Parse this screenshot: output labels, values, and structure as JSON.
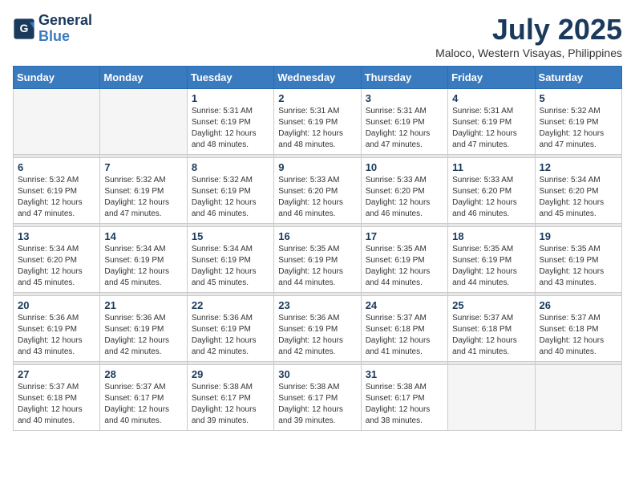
{
  "header": {
    "logo_line1": "General",
    "logo_line2": "Blue",
    "title": "July 2025",
    "subtitle": "Maloco, Western Visayas, Philippines"
  },
  "days_of_week": [
    "Sunday",
    "Monday",
    "Tuesday",
    "Wednesday",
    "Thursday",
    "Friday",
    "Saturday"
  ],
  "weeks": [
    [
      {
        "num": "",
        "info": ""
      },
      {
        "num": "",
        "info": ""
      },
      {
        "num": "1",
        "info": "Sunrise: 5:31 AM\nSunset: 6:19 PM\nDaylight: 12 hours\nand 48 minutes."
      },
      {
        "num": "2",
        "info": "Sunrise: 5:31 AM\nSunset: 6:19 PM\nDaylight: 12 hours\nand 48 minutes."
      },
      {
        "num": "3",
        "info": "Sunrise: 5:31 AM\nSunset: 6:19 PM\nDaylight: 12 hours\nand 47 minutes."
      },
      {
        "num": "4",
        "info": "Sunrise: 5:31 AM\nSunset: 6:19 PM\nDaylight: 12 hours\nand 47 minutes."
      },
      {
        "num": "5",
        "info": "Sunrise: 5:32 AM\nSunset: 6:19 PM\nDaylight: 12 hours\nand 47 minutes."
      }
    ],
    [
      {
        "num": "6",
        "info": "Sunrise: 5:32 AM\nSunset: 6:19 PM\nDaylight: 12 hours\nand 47 minutes."
      },
      {
        "num": "7",
        "info": "Sunrise: 5:32 AM\nSunset: 6:19 PM\nDaylight: 12 hours\nand 47 minutes."
      },
      {
        "num": "8",
        "info": "Sunrise: 5:32 AM\nSunset: 6:19 PM\nDaylight: 12 hours\nand 46 minutes."
      },
      {
        "num": "9",
        "info": "Sunrise: 5:33 AM\nSunset: 6:20 PM\nDaylight: 12 hours\nand 46 minutes."
      },
      {
        "num": "10",
        "info": "Sunrise: 5:33 AM\nSunset: 6:20 PM\nDaylight: 12 hours\nand 46 minutes."
      },
      {
        "num": "11",
        "info": "Sunrise: 5:33 AM\nSunset: 6:20 PM\nDaylight: 12 hours\nand 46 minutes."
      },
      {
        "num": "12",
        "info": "Sunrise: 5:34 AM\nSunset: 6:20 PM\nDaylight: 12 hours\nand 45 minutes."
      }
    ],
    [
      {
        "num": "13",
        "info": "Sunrise: 5:34 AM\nSunset: 6:20 PM\nDaylight: 12 hours\nand 45 minutes."
      },
      {
        "num": "14",
        "info": "Sunrise: 5:34 AM\nSunset: 6:19 PM\nDaylight: 12 hours\nand 45 minutes."
      },
      {
        "num": "15",
        "info": "Sunrise: 5:34 AM\nSunset: 6:19 PM\nDaylight: 12 hours\nand 45 minutes."
      },
      {
        "num": "16",
        "info": "Sunrise: 5:35 AM\nSunset: 6:19 PM\nDaylight: 12 hours\nand 44 minutes."
      },
      {
        "num": "17",
        "info": "Sunrise: 5:35 AM\nSunset: 6:19 PM\nDaylight: 12 hours\nand 44 minutes."
      },
      {
        "num": "18",
        "info": "Sunrise: 5:35 AM\nSunset: 6:19 PM\nDaylight: 12 hours\nand 44 minutes."
      },
      {
        "num": "19",
        "info": "Sunrise: 5:35 AM\nSunset: 6:19 PM\nDaylight: 12 hours\nand 43 minutes."
      }
    ],
    [
      {
        "num": "20",
        "info": "Sunrise: 5:36 AM\nSunset: 6:19 PM\nDaylight: 12 hours\nand 43 minutes."
      },
      {
        "num": "21",
        "info": "Sunrise: 5:36 AM\nSunset: 6:19 PM\nDaylight: 12 hours\nand 42 minutes."
      },
      {
        "num": "22",
        "info": "Sunrise: 5:36 AM\nSunset: 6:19 PM\nDaylight: 12 hours\nand 42 minutes."
      },
      {
        "num": "23",
        "info": "Sunrise: 5:36 AM\nSunset: 6:19 PM\nDaylight: 12 hours\nand 42 minutes."
      },
      {
        "num": "24",
        "info": "Sunrise: 5:37 AM\nSunset: 6:18 PM\nDaylight: 12 hours\nand 41 minutes."
      },
      {
        "num": "25",
        "info": "Sunrise: 5:37 AM\nSunset: 6:18 PM\nDaylight: 12 hours\nand 41 minutes."
      },
      {
        "num": "26",
        "info": "Sunrise: 5:37 AM\nSunset: 6:18 PM\nDaylight: 12 hours\nand 40 minutes."
      }
    ],
    [
      {
        "num": "27",
        "info": "Sunrise: 5:37 AM\nSunset: 6:18 PM\nDaylight: 12 hours\nand 40 minutes."
      },
      {
        "num": "28",
        "info": "Sunrise: 5:37 AM\nSunset: 6:17 PM\nDaylight: 12 hours\nand 40 minutes."
      },
      {
        "num": "29",
        "info": "Sunrise: 5:38 AM\nSunset: 6:17 PM\nDaylight: 12 hours\nand 39 minutes."
      },
      {
        "num": "30",
        "info": "Sunrise: 5:38 AM\nSunset: 6:17 PM\nDaylight: 12 hours\nand 39 minutes."
      },
      {
        "num": "31",
        "info": "Sunrise: 5:38 AM\nSunset: 6:17 PM\nDaylight: 12 hours\nand 38 minutes."
      },
      {
        "num": "",
        "info": ""
      },
      {
        "num": "",
        "info": ""
      }
    ]
  ]
}
